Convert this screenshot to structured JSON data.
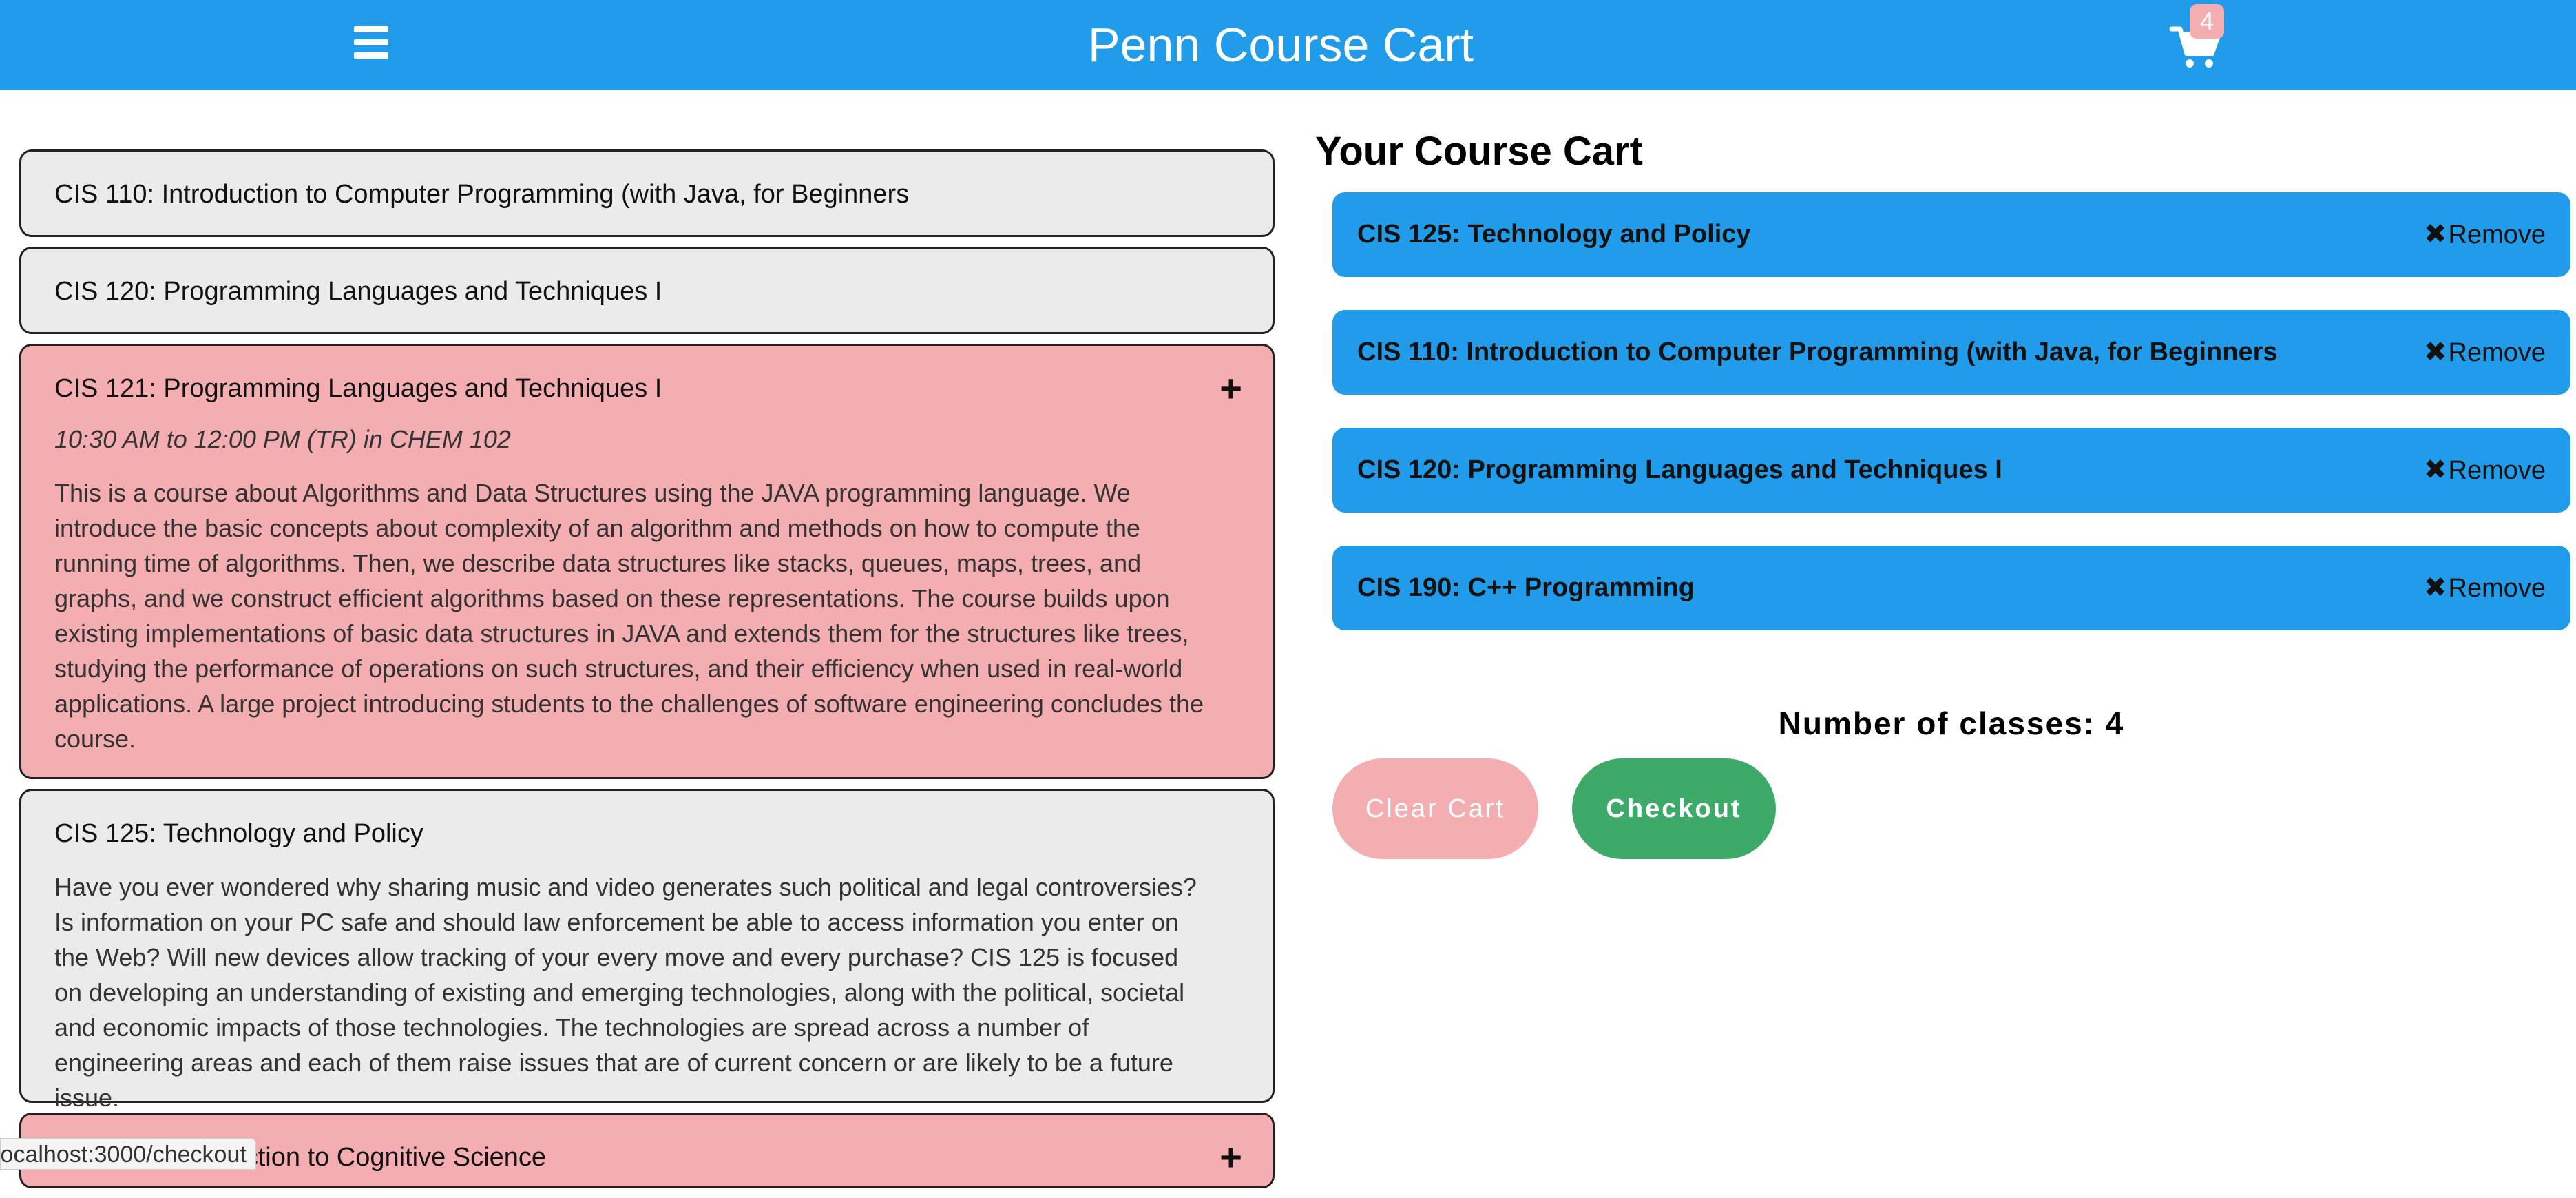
{
  "navbar": {
    "menu_icon": "hamburger-menu-icon",
    "brand": "Penn Course Cart",
    "cart_icon": "shopping-cart-icon",
    "cart_badge": "4"
  },
  "colors": {
    "primary": "#219CEB",
    "selected": "#F4AEB2",
    "course_bg": "#EBEBEB",
    "checkout": "#3DAA6A"
  },
  "courses": [
    {
      "title": "CIS 110: Introduction to Computer Programming (with Java, for Beginners"
    },
    {
      "title": "CIS 120: Programming Languages and Techniques I"
    },
    {
      "title": "CIS 121: Programming Languages and Techniques I",
      "time": "10:30 AM to 12:00 PM (TR) in CHEM 102",
      "description": "This is a course about Algorithms and Data Structures using the JAVA programming language. We introduce the basic concepts about complexity of an algorithm and methods on how to compute the running time of algorithms. Then, we describe data structures like stacks, queues, maps, trees, and graphs, and we construct efficient algorithms based on these representations. The course builds upon existing implementations of basic data structures in JAVA and extends them for the structures like trees, studying the performance of operations on such structures, and their efficiency when used in real-world applications. A large project introducing students to the challenges of software engineering concludes the course.",
      "add_symbol": "+"
    },
    {
      "title": "CIS 125: Technology and Policy",
      "description": "Have you ever wondered why sharing music and video generates such political and legal controversies? Is information on your PC safe and should law enforcement be able to access information you enter on the Web? Will new devices allow tracking of your every move and every purchase? CIS 125 is focused on developing an understanding of existing and emerging technologies, along with the political, societal and economic impacts of those technologies. The technologies are spread across a number of engineering areas and each of them raise issues that are of current concern or are likely to be a future issue."
    },
    {
      "title": "CIS 140: Introduction to Cognitive Science",
      "add_symbol": "+"
    }
  ],
  "status_url": "localhost:3000/checkout",
  "cart": {
    "heading": "Your Course Cart",
    "remove_label": "Remove",
    "remove_symbol": "✖",
    "items": [
      "CIS 125: Technology and Policy",
      "CIS 110: Introduction to Computer Programming (with Java, for Beginners",
      "CIS 120: Programming Languages and Techniques I",
      "CIS 190: C++ Programming"
    ],
    "count_text": "Number of classes: 4",
    "clear_label": "Clear Cart",
    "checkout_label": "Checkout"
  }
}
